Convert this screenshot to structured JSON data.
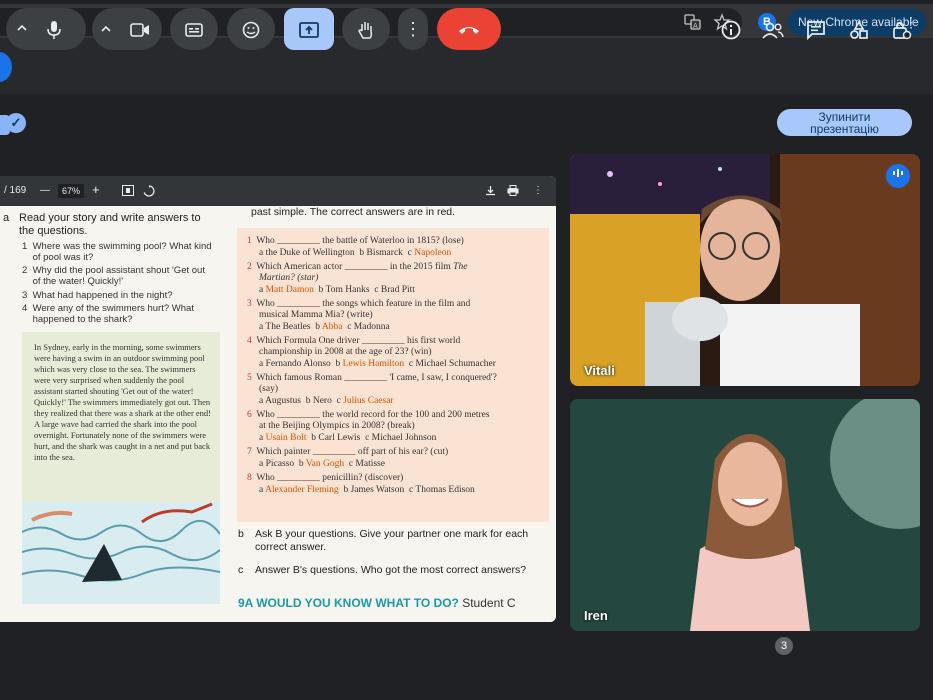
{
  "browser": {
    "profile_initial": "B",
    "update_label": "New Chrome available",
    "menu_glyph": "⋮",
    "icons": [
      "translate-icon",
      "star-icon"
    ]
  },
  "meet": {
    "stop_presenting_label": "Зупинити\nпрезентацію"
  },
  "pdf_viewer": {
    "page_indicator": "/ 169",
    "zoom_minus": "—",
    "zoom_level": "67%",
    "zoom_plus": "+",
    "icons": [
      "fit-page-icon",
      "rotate-icon",
      "download-icon",
      "print-icon",
      "more-icon"
    ]
  },
  "pdf_content": {
    "exercise_a_marker": "a",
    "exercise_a_title": "Read your story and write answers to",
    "exercise_a_title2": "the questions.",
    "questions": [
      {
        "n": "1",
        "l1": "Where was the swimming pool? What kind",
        "l2": "of pool was it?"
      },
      {
        "n": "2",
        "l1": "Why did the pool assistant shout 'Get out",
        "l2": "of the water! Quickly!'"
      },
      {
        "n": "3",
        "l1": "What had happened in the night?",
        "l2": ""
      },
      {
        "n": "4",
        "l1": "Were any of the swimmers hurt? What",
        "l2": "happened to the shark?"
      }
    ],
    "story": "In Sydney, early in the morning, some swimmers were having a swim in an outdoor swimming pool which was very close to the sea. The swimmers were very surprised when suddenly the pool assistant started shouting 'Get out of the water! Quickly!' The swimmers immediately got out. Then they realized that there was a shark at the other end! A large wave had carried the shark into the pool overnight. Fortunately none of the swimmers were hurt, and the shark was caught in a net and put back into the sea.",
    "quiz_header": "past simple. The correct answers are in red.",
    "quiz": [
      {
        "n": "1",
        "q": "Who _________ the battle of Waterloo in 1815? (lose)",
        "q2": "",
        "a": "a the Duke of Wellington",
        "b": "b Bismarck",
        "c": "c ",
        "c_ans": "Napoleon",
        "ans": "c"
      },
      {
        "n": "2",
        "q": "Which American actor _________ in the 2015 film ",
        "q_it": "The",
        "q2": "Martian? (star)",
        "a_ans": "Matt Damon",
        "b": "b Tom Hanks",
        "c": "c Brad Pitt",
        "ans": "a"
      },
      {
        "n": "3",
        "q": "Who _________ the songs which feature in the film and",
        "q2": "musical Mamma Mia? (write)",
        "a": "a The Beatles",
        "b_pre": "b ",
        "b_ans": "Abba",
        "c": "c Madonna",
        "ans": "b"
      },
      {
        "n": "4",
        "q": "Which Formula One driver _________ his first world",
        "q2": "championship in 2008 at the age of 23? (win)",
        "a": "a Fernando Alonso",
        "b_pre": "b ",
        "b_ans": "Lewis Hamilton",
        "c": "c Michael Schumacher",
        "ans": "b"
      },
      {
        "n": "5",
        "q": "Which famous Roman _________ 'I came, I saw, I conquered'?",
        "q2": "(say)",
        "a": "a Augustus",
        "b": "b Nero",
        "c": "c ",
        "c_ans": "Julius Caesar",
        "ans": "c"
      },
      {
        "n": "6",
        "q": "Who _________ the world record for the 100 and 200 metres",
        "q2": "at the Beijing Olympics in 2008? (break)",
        "a_ans": "Usain Bolt",
        "b": "b Carl Lewis",
        "c": "c Michael Johnson",
        "ans": "a"
      },
      {
        "n": "7",
        "q": "Which painter _________ off part of his ear? (cut)",
        "q2": "",
        "a": "a Picasso",
        "b_pre": "b ",
        "b_ans": "Van Gogh",
        "c": "c Matisse",
        "ans": "b"
      },
      {
        "n": "8",
        "q": "Who _________ penicillin? (discover)",
        "q2": "",
        "a_ans": "Alexander Fleming",
        "b": "b James Watson",
        "c": "c Thomas Edison",
        "ans": "a"
      }
    ],
    "section_b_marker": "b",
    "section_b_text1": "Ask B your questions. Give your partner one mark for each",
    "section_b_text2": "correct answer.",
    "section_c_marker": "c",
    "section_c_text": "Answer B's questions. Who got the most correct answers?",
    "lesson_footer": "9A  WOULD YOU KNOW WHAT TO DO?",
    "lesson_footer_tail": "Student C"
  },
  "participants": [
    {
      "name": "Vitali"
    },
    {
      "name": "Iren"
    }
  ],
  "controls": {
    "people_count": "3",
    "icons": [
      "chevron-up-icon",
      "mic-icon",
      "chevron-up-icon",
      "camera-icon",
      "captions-icon",
      "emoji-icon",
      "present-icon",
      "raise-hand-icon",
      "more-options-icon",
      "end-call-icon",
      "info-icon",
      "people-icon",
      "chat-icon",
      "activities-icon",
      "host-controls-icon"
    ]
  },
  "colors": {
    "meet_bg": "#202124",
    "accent": "#a8c7fa",
    "end_call": "#ea4335",
    "answer_red": "#d35400"
  }
}
